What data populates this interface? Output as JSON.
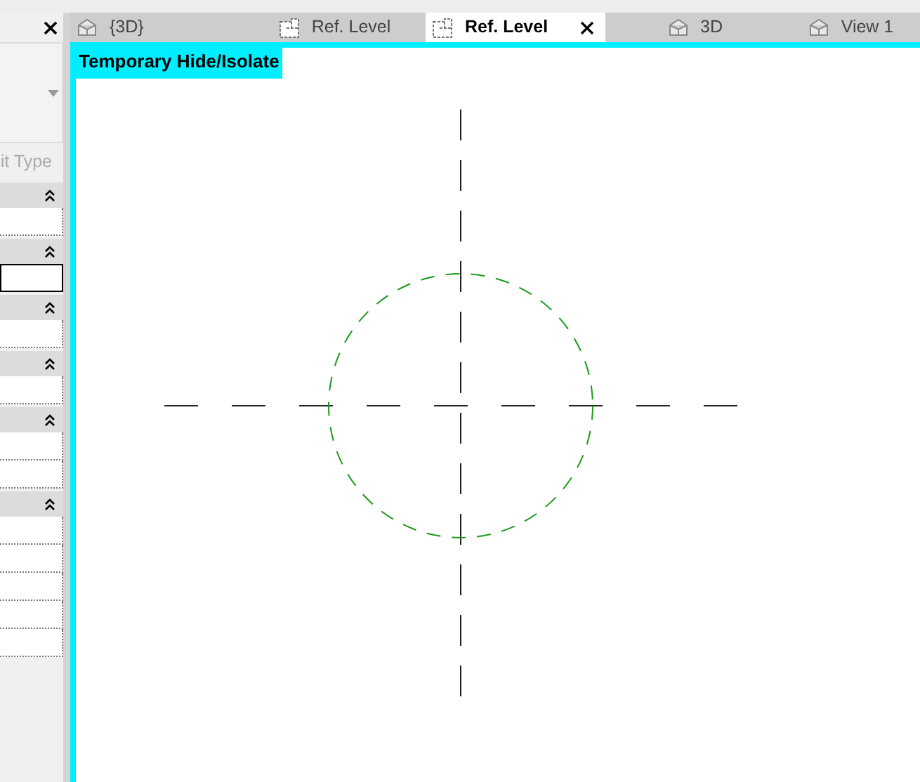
{
  "properties_panel": {
    "type_selector_caption": "it Type",
    "groups": [
      {
        "expanded": true,
        "rows": [
          {
            "selected": false
          }
        ]
      },
      {
        "expanded": true,
        "rows": [
          {
            "selected": true
          }
        ]
      },
      {
        "expanded": true,
        "rows": [
          {
            "selected": false
          }
        ]
      },
      {
        "expanded": true,
        "rows": [
          {
            "selected": false
          }
        ]
      },
      {
        "expanded": true,
        "rows": [
          {
            "selected": false
          },
          {
            "selected": false
          }
        ]
      },
      {
        "expanded": true,
        "rows": [
          {
            "selected": false
          },
          {
            "selected": false
          },
          {
            "selected": false
          },
          {
            "selected": false
          },
          {
            "selected": false
          }
        ]
      }
    ]
  },
  "tabs": [
    {
      "label": "{3D}",
      "kind": "perspective",
      "selected": false
    },
    {
      "label": "Ref. Level",
      "kind": "plan",
      "selected": false
    },
    {
      "label": "Ref. Level",
      "kind": "plan",
      "selected": true
    },
    {
      "label": "3D",
      "kind": "perspective",
      "selected": false
    },
    {
      "label": "View 1",
      "kind": "perspective",
      "selected": false
    }
  ],
  "view": {
    "mode_banner": "Temporary Hide/Isolate"
  }
}
